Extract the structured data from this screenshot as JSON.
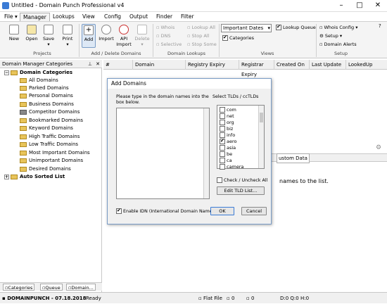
{
  "window": {
    "title": "Untitled - Domain Punch Professional v4"
  },
  "menu": {
    "file": "File",
    "tabs": [
      "Manager",
      "Lookups",
      "View",
      "Config",
      "Output",
      "Finder",
      "Filter"
    ]
  },
  "ribbon": {
    "projects": {
      "new": "New",
      "open": "Open",
      "save": "Save",
      "print": "Print",
      "label": "Projects"
    },
    "add_delete": {
      "add": "Add",
      "import": "Import",
      "api_import_1": "API",
      "api_import_2": "Import",
      "delete": "Delete",
      "label": "Add / Delete Domains"
    },
    "lookups": {
      "whois": "Whois",
      "dns": "DNS",
      "selective": "Selective",
      "lookup_all": "Lookup All",
      "stop_all": "Stop All",
      "stop_some": "Stop Some",
      "label": "Domain Lookups"
    },
    "views": {
      "sort_value": "Important Dates",
      "lookup_queue": "Lookup Queue",
      "categories": "Categories",
      "label": "Views"
    },
    "setup": {
      "whois_config": "Whois Config",
      "setup": "Setup",
      "domain_alerts": "Domain Alerts",
      "label": "Setup"
    }
  },
  "left_panel": {
    "title": "Domain Manager Categories",
    "root": "Domain Categories",
    "items": [
      "All Domains",
      "Parked Domains",
      "Personal Domains",
      "Business Domains",
      "Competitor Domains",
      "Bookmarked Domains",
      "Keyword Domains",
      "High Traffic Domains",
      "Low Traffic Domains",
      "Most Important Domains",
      "Unimportant Domains",
      "Desired Domains"
    ],
    "auto_sorted": "Auto Sorted List",
    "tabs": [
      "Categories",
      "Queue",
      "Domain..."
    ]
  },
  "grid": {
    "columns": [
      "#",
      "Domain",
      "Registry Expiry",
      "Registrar Expiry",
      "Created On",
      "Last Update",
      "LookedUp"
    ]
  },
  "background": {
    "custom_data_tab": "ustom Data",
    "message": "names to the list."
  },
  "dialog": {
    "title": "Add Domains",
    "instructions": "Please type in the domain names into the box below.",
    "tld_label": "Select TLDs / ccTLDs",
    "tlds": [
      {
        "name": "com",
        "checked": false
      },
      {
        "name": "net",
        "checked": false
      },
      {
        "name": "org",
        "checked": false
      },
      {
        "name": "biz",
        "checked": false
      },
      {
        "name": "info",
        "checked": false
      },
      {
        "name": "aero",
        "checked": true
      },
      {
        "name": "asia",
        "checked": false
      },
      {
        "name": "be",
        "checked": false
      },
      {
        "name": "ca",
        "checked": false
      },
      {
        "name": "camera",
        "checked": false
      }
    ],
    "check_uncheck_all": "Check / Uncheck All",
    "edit_tld_list": "Edit TLD List...",
    "enable_idn": "Enable IDN (International Domain Names)",
    "ok": "OK",
    "cancel": "Cancel"
  },
  "status": {
    "app": "DOMAINPUNCH - 07.18.2018",
    "ready": "Ready",
    "file_type": "Flat File",
    "count1": "0",
    "count2": "0",
    "counters": "D:0 Q:0 H:0"
  }
}
